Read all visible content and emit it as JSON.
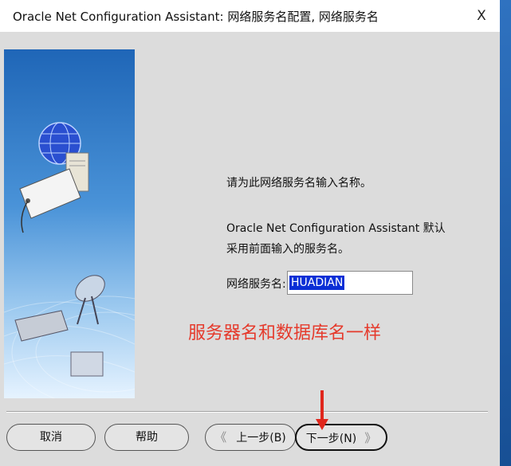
{
  "window": {
    "title": "Oracle Net Configuration Assistant: 网络服务名配置, 网络服务名",
    "close_glyph": "X"
  },
  "content": {
    "prompt": "请为此网络服务名输入名称。",
    "info_line1": "Oracle Net Configuration Assistant 默认",
    "info_line2": "采用前面输入的服务名。",
    "field_label": "网络服务名:",
    "field_value": "HUADIAN"
  },
  "annotation": {
    "text": "服务器名和数据库名一样",
    "color": "#e53a2c"
  },
  "buttons": {
    "cancel": "取消",
    "help": "帮助",
    "back": "上一步(B)",
    "next": "下一步(N)",
    "back_arrow": "《",
    "next_arrow": "》"
  },
  "icons": {
    "side_image": "network-globe-server-satellite-illustration",
    "close": "close-icon",
    "annotation_arrow": "red-down-arrow"
  }
}
